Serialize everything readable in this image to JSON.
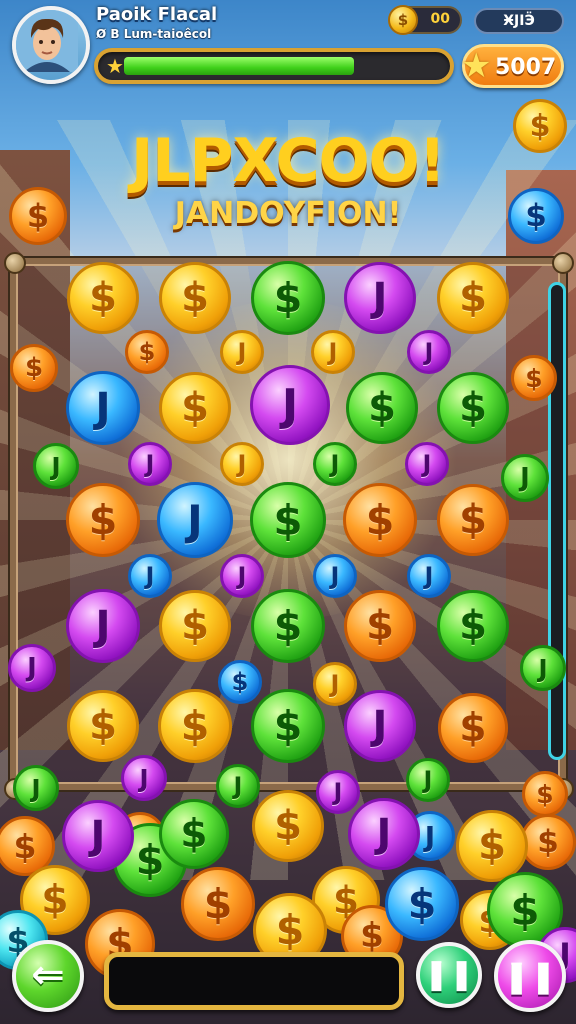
{
  "player": {
    "name": "Paoik Flacal",
    "subtitle": "Ø B Lum-taioêcol",
    "level_progress": 0.72
  },
  "currency": {
    "coin_symbol": "$",
    "coin_count": "00",
    "menu_label": "ӾЈӀӬ",
    "star_glyph": "★",
    "score": "5007"
  },
  "title": {
    "main": "JLPXCOO!",
    "sub": "JANDOYFION!"
  },
  "glyphs": {
    "dollar": "$",
    "j": "J"
  },
  "controls": {
    "back_glyph": "⇐",
    "pause_glyph": "❚❚",
    "message_text": ""
  },
  "colors": {
    "gold": "#ffd02a",
    "orange": "#ffa028",
    "green": "#5ee23a",
    "blue": "#3ab8ff",
    "purple": "#d44af0",
    "cyan": "#4ee6f0",
    "progress_fill": "#3fd01a",
    "frame": "#8b6a4a"
  }
}
